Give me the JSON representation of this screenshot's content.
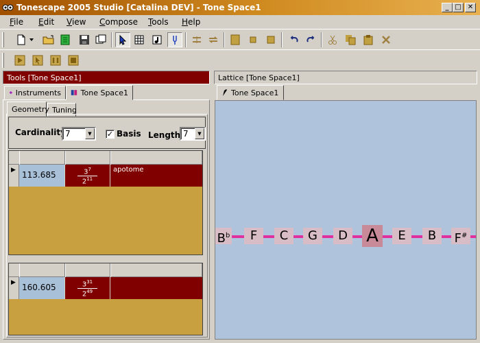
{
  "window": {
    "title": "Tonescape 2005 Studio [Catalina DEV]  -  Tone Space1"
  },
  "menu": {
    "items": [
      {
        "label": "File",
        "mnemonic": "F",
        "rest": "ile"
      },
      {
        "label": "Edit",
        "mnemonic": "E",
        "rest": "dit"
      },
      {
        "label": "View",
        "mnemonic": "V",
        "rest": "iew"
      },
      {
        "label": "Compose",
        "mnemonic": "C",
        "rest": "ompose"
      },
      {
        "label": "Tools",
        "mnemonic": "T",
        "rest": "ools"
      },
      {
        "label": "Help",
        "mnemonic": "H",
        "rest": "elp"
      }
    ]
  },
  "tools_panel": {
    "header": "Tools  [Tone Space1]",
    "tabs": [
      "Instruments",
      "Tone Space1"
    ],
    "subtabs": [
      "Geometry",
      "Tuning"
    ],
    "cardinality_label": "Cardinality",
    "cardinality_value": "7",
    "basis_label": "Basis",
    "basis_checked": true,
    "length_label": "Length",
    "length_value": "7",
    "grids": [
      {
        "rows": [
          {
            "cents": "113.685",
            "num_base": "3",
            "num_exp": "7",
            "den_base": "2",
            "den_exp": "11",
            "name": "apotome"
          }
        ]
      },
      {
        "rows": [
          {
            "cents": "160.605",
            "num_base": "3",
            "num_exp": "31",
            "den_base": "2",
            "den_exp": "49",
            "name": ""
          }
        ]
      }
    ]
  },
  "lattice_panel": {
    "header": "Lattice  [Tone Space1]",
    "tab": "Tone Space1",
    "notes": [
      {
        "name": "B",
        "accidental": "b",
        "selected": false
      },
      {
        "name": "F",
        "accidental": "",
        "selected": false
      },
      {
        "name": "C",
        "accidental": "",
        "selected": false
      },
      {
        "name": "G",
        "accidental": "",
        "selected": false
      },
      {
        "name": "D",
        "accidental": "",
        "selected": false
      },
      {
        "name": "A",
        "accidental": "",
        "selected": true
      },
      {
        "name": "E",
        "accidental": "",
        "selected": false
      },
      {
        "name": "B",
        "accidental": "",
        "selected": false
      },
      {
        "name": "F",
        "accidental": "#",
        "selected": false
      }
    ],
    "line_color": "#e030a0",
    "canvas_color": "#afc3dc"
  },
  "colors": {
    "accent_dark_red": "#800000",
    "cell_blue": "#a8c0d8",
    "grid_gold": "#c8a040"
  }
}
